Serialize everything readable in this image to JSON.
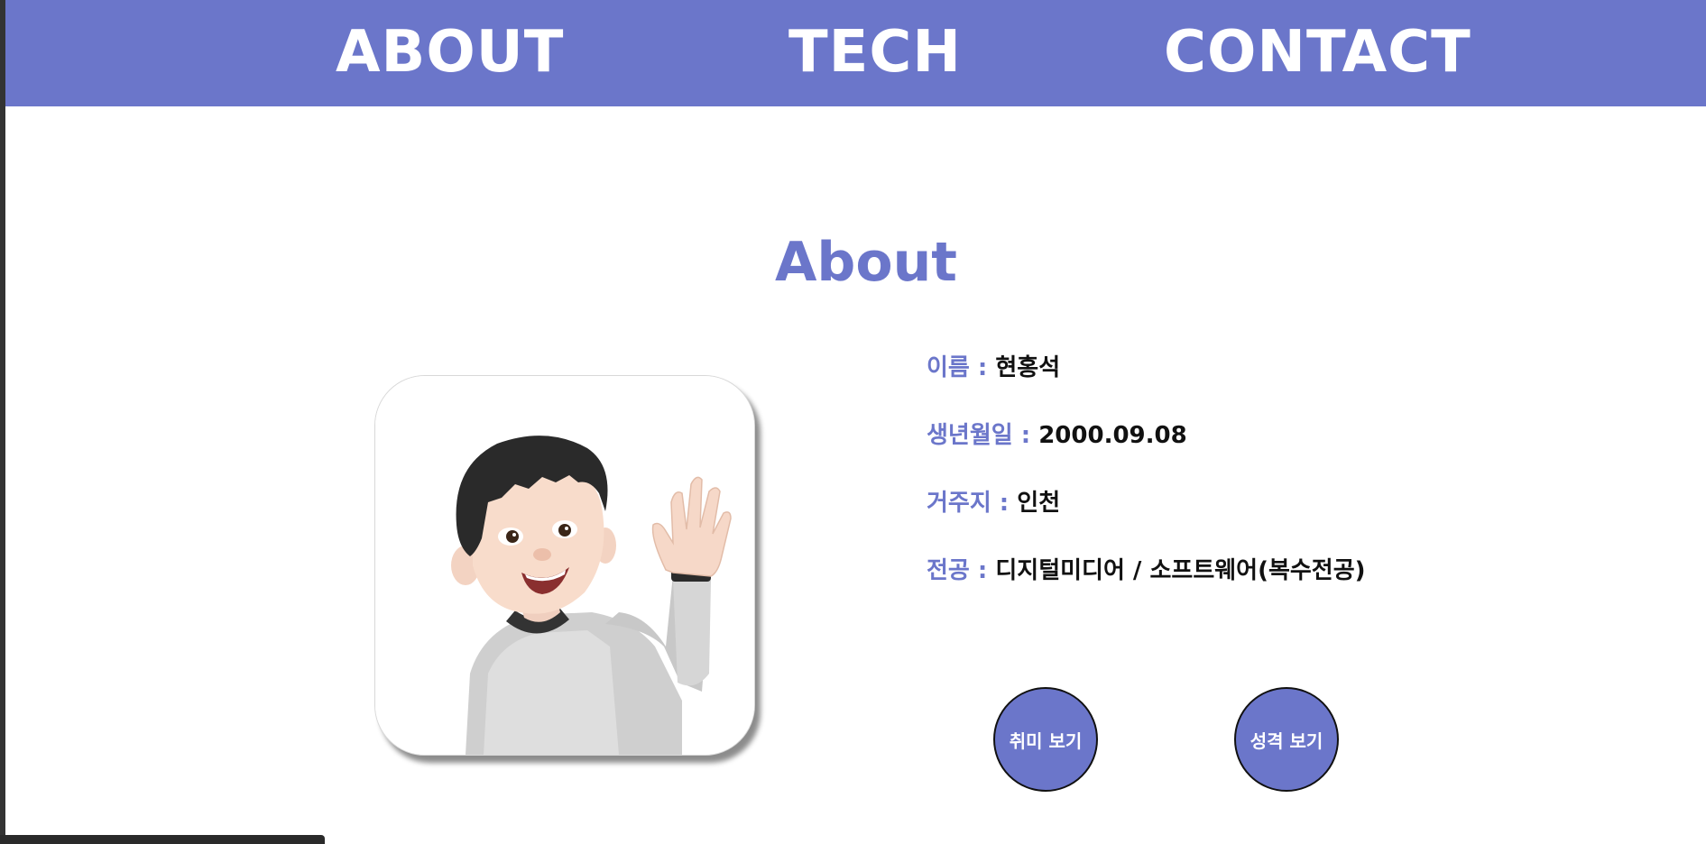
{
  "nav": {
    "items": [
      {
        "label": "ABOUT"
      },
      {
        "label": "TECH"
      },
      {
        "label": "CONTACT"
      }
    ],
    "background_color": "#6b76ca"
  },
  "about": {
    "title": "About",
    "profile_image": "waving-memoji-avatar",
    "fields": [
      {
        "label": "이름 :",
        "value": "현홍석"
      },
      {
        "label": "생년월일 :",
        "value": "2000.09.08"
      },
      {
        "label": "거주지 :",
        "value": "인천"
      },
      {
        "label": "전공 :",
        "value": "디지털미디어 / 소프트웨어(복수전공)"
      }
    ],
    "buttons": [
      {
        "label": "취미 보기"
      },
      {
        "label": "성격 보기"
      }
    ],
    "accent_color": "#6b76ca"
  }
}
